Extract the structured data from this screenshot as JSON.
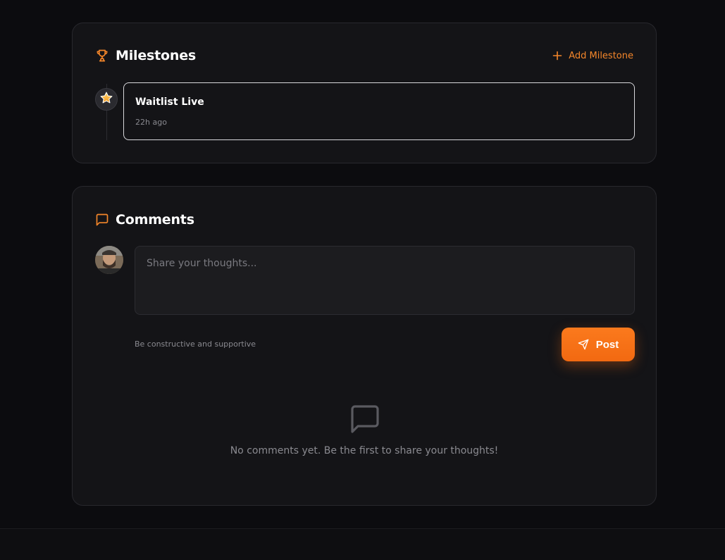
{
  "milestones": {
    "title": "Milestones",
    "add_label": "Add Milestone",
    "items": [
      {
        "title": "Waitlist Live",
        "time": "22h ago",
        "icon": "star-icon"
      }
    ]
  },
  "comments": {
    "title": "Comments",
    "placeholder": "Share your thoughts...",
    "hint": "Be constructive and supportive",
    "post_label": "Post",
    "empty_text": "No comments yet. Be the first to share your thoughts!"
  },
  "colors": {
    "accent": "#f4862a",
    "button": "#f26911",
    "background": "#0c0c0f",
    "card": "#141417"
  }
}
